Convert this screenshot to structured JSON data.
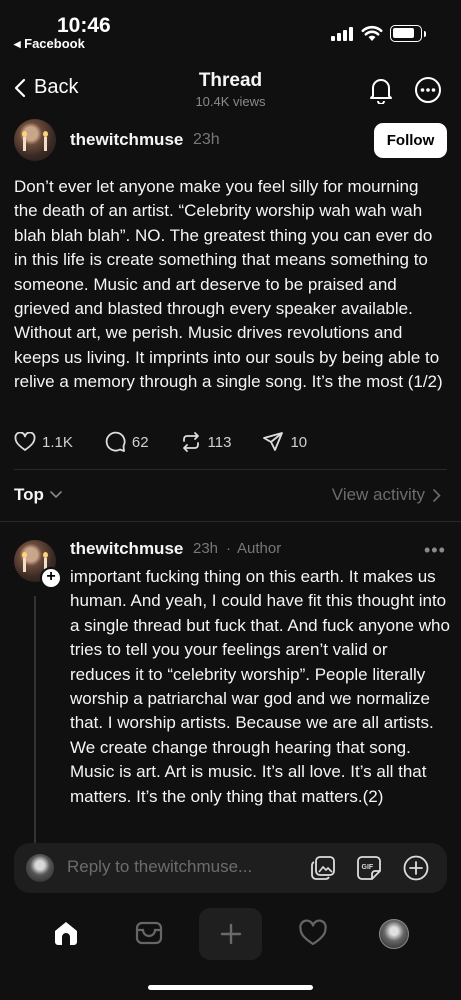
{
  "status_bar": {
    "time": "10:46",
    "back_app": "◂ Facebook"
  },
  "nav": {
    "back_label": "Back",
    "title": "Thread",
    "subtitle": "10.4K views"
  },
  "post": {
    "username": "thewitchmuse",
    "time": "23h",
    "follow_label": "Follow",
    "body": "Don’t ever let anyone make you feel silly for mourning the death of an artist. “Celebrity worship wah wah wah blah blah blah”. NO. The greatest thing you can ever do in this life is create something that means something to someone. Music and art deserve to be praised and grieved and blasted through every speaker available. Without art, we perish. Music drives revolutions and keeps us living. It imprints into our souls by being able to relive a memory through a single song. It’s the most (1/2)",
    "likes": "1.1K",
    "replies": "62",
    "reposts": "113",
    "shares": "10"
  },
  "sort": {
    "label": "Top",
    "view_activity": "View activity"
  },
  "reply": {
    "username": "thewitchmuse",
    "time": "23h",
    "separator": "·",
    "author_tag": "Author",
    "more": "•••",
    "plus": "+",
    "body": "important fucking thing on this earth. It makes us human. And yeah, I could have fit this thought into a single thread but fuck that. And fuck anyone who tries to tell you your feelings aren’t valid or reduces it to “celebrity worship”. People literally worship a patriarchal war god and we normalize that. I worship artists. Because we are all artists. We create change through hearing that song. Music is art. Art is music. It’s all love. It’s all that matters. It’s the only thing that matters.(2)"
  },
  "composer": {
    "placeholder": "Reply to thewitchmuse...",
    "gif_label": "GIF"
  },
  "icons": [
    "chevron-left-icon",
    "bell-icon",
    "more-circle-icon",
    "heart-icon",
    "comment-icon",
    "repost-icon",
    "send-icon",
    "chevron-down-icon",
    "chevron-right-icon",
    "image-icon",
    "gif-icon",
    "add-circle-icon",
    "home-icon",
    "inbox-icon",
    "plus-icon",
    "heart-tab-icon"
  ],
  "colors": {
    "background": "#101010",
    "text": "#f3f5f7",
    "muted": "#777777"
  }
}
